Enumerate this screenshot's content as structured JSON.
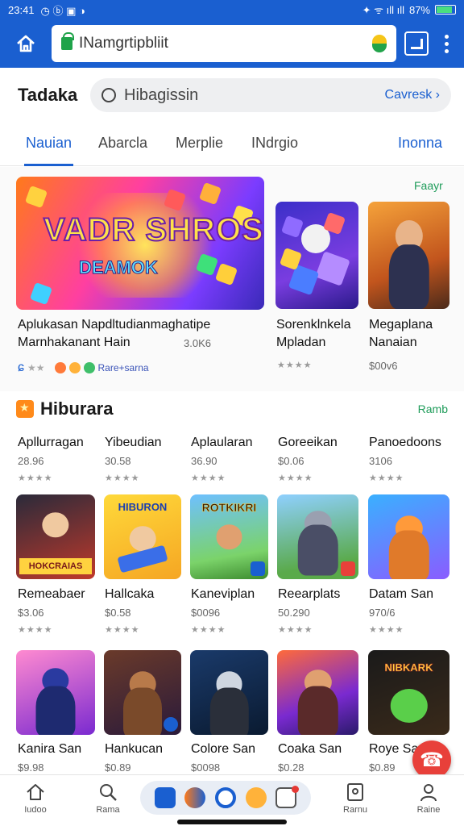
{
  "status": {
    "time": "23:41",
    "battery": "87%"
  },
  "toolbar": {
    "url": "INamgrtipbliit"
  },
  "header": {
    "brand": "Tadaka",
    "search_text": "Hibagissin",
    "search_action": "Cavresk"
  },
  "categories": [
    "Nauian",
    "Abarcla",
    "Merplie",
    "INdrgio",
    "Inonna"
  ],
  "featured": {
    "more": "Faayr",
    "banner": {
      "title": "VADR SHROS",
      "subtitle": "DEAMOK",
      "name": "Aplukasan Napdltudianmaghatipe",
      "name2": "Marnhakanant Hain",
      "size": "3.0K6",
      "badge": "Rare+sarna"
    },
    "apps": [
      {
        "name": "Sorenklnkela",
        "sub": "Mpladan",
        "price": ""
      },
      {
        "name": "Megaplana",
        "sub": "Nanaian",
        "price": "$00v6"
      }
    ]
  },
  "section2": {
    "title": "Hiburara",
    "more": "Ramb",
    "top_list": [
      {
        "name": "Apllurragan",
        "price": "28.96"
      },
      {
        "name": "Yibeudian",
        "price": "30.58"
      },
      {
        "name": "Aplaularan",
        "price": "36.90"
      },
      {
        "name": "Goreeikan",
        "price": "$0.06"
      },
      {
        "name": "Panoedoons",
        "price": "3106"
      }
    ],
    "row1": [
      {
        "name": "Remeabaer",
        "price": "$3.06",
        "art": "HOKCRAIAS"
      },
      {
        "name": "Hallcaka",
        "price": "$0.58",
        "art": "HIBURON"
      },
      {
        "name": "Kaneviplan",
        "price": "$0096",
        "art": "ROTKIKRI"
      },
      {
        "name": "Reearplats",
        "price": "50.290",
        "art": ""
      },
      {
        "name": "Datam San",
        "price": "970/6",
        "art": ""
      }
    ],
    "row2": [
      {
        "name": "Kanira San",
        "price": "$9.98",
        "art": ""
      },
      {
        "name": "Hankucan",
        "price": "$0.89",
        "art": ""
      },
      {
        "name": "Colore San",
        "price": "$0098",
        "art": ""
      },
      {
        "name": "Coaka San",
        "price": "$0.28",
        "art": ""
      },
      {
        "name": "Roye Sa",
        "price": "$0.89",
        "art": "NIBKARK"
      }
    ]
  },
  "bottom_nav": {
    "home": "Iudoo",
    "search": "Rama",
    "library": "Rarnu",
    "profile": "Raine"
  },
  "colors": {
    "primary": "#1a5fd0",
    "accent_green": "#1f9c5a",
    "fab": "#e8403a"
  }
}
